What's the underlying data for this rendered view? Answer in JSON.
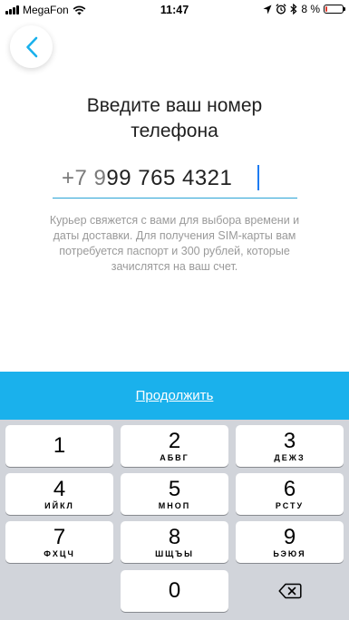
{
  "status_bar": {
    "carrier": "MegaFon",
    "time": "11:47",
    "battery_text": "8 %",
    "battery_level": 8,
    "icons": [
      "signal-icon",
      "wifi-icon",
      "location-icon",
      "alarm-icon",
      "bluetooth-icon",
      "battery-icon"
    ]
  },
  "nav": {
    "back_icon": "chevron-left-icon",
    "accent": "#1ab1ec"
  },
  "title": {
    "line1": "Введите ваш номер",
    "line2": "телефона"
  },
  "phone": {
    "prefix": "+7 9",
    "value": "99 765 4321"
  },
  "hint": "Курьер свяжется с вами для выбора времени и даты доставки. Для получения SIM-карты вам потребуется паспорт и 300 рублей, которые зачислятся на ваш счет.",
  "continue": {
    "label": "Продолжить",
    "background": "#1ab1ec"
  },
  "keypad": {
    "keys": [
      {
        "digit": "1",
        "letters": ""
      },
      {
        "digit": "2",
        "letters": "АБВГ"
      },
      {
        "digit": "3",
        "letters": "ДЕЖЗ"
      },
      {
        "digit": "4",
        "letters": "ИЙКЛ"
      },
      {
        "digit": "5",
        "letters": "МНОП"
      },
      {
        "digit": "6",
        "letters": "РСТУ"
      },
      {
        "digit": "7",
        "letters": "ФХЦЧ"
      },
      {
        "digit": "8",
        "letters": "ШЩЪЫ"
      },
      {
        "digit": "9",
        "letters": "ЬЭЮЯ"
      },
      {
        "digit": "0",
        "letters": ""
      }
    ],
    "delete_icon": "backspace-icon"
  }
}
